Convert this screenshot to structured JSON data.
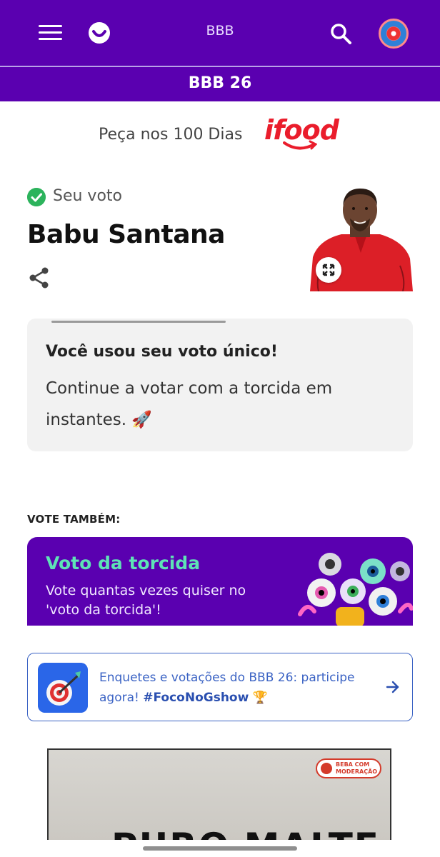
{
  "header": {
    "title": "BBB",
    "subtitle": "BBB 26",
    "colors": {
      "primary": "#5a00b0",
      "accent_green": "#5ee3b6"
    }
  },
  "promo": {
    "text": "Peça nos 100 Dias",
    "brand": "ifood"
  },
  "vote": {
    "status_label": "Seu voto",
    "candidate_name": "Babu Santana",
    "icons": {
      "status": "check-circle-icon",
      "share": "share-icon",
      "expand": "expand-icon"
    }
  },
  "info_card": {
    "bold_text": "Você usou seu voto único!",
    "body_text": "Continue a votar com a torcida em instantes. 🚀"
  },
  "vote_also": {
    "heading": "VOTE TAMBÉM:",
    "card_title": "Voto da torcida",
    "card_description": "Vote quantas vezes quiser no 'voto da torcida'!"
  },
  "enquete": {
    "text": "Enquetes e votações do BBB 26: participe agora!",
    "hashtag": "#FocoNoGshow",
    "emoji": "🏆"
  },
  "ad": {
    "badge_line1": "BEBA COM",
    "badge_line2": "MODERAÇÃO",
    "headline": "PURO MALTE"
  }
}
